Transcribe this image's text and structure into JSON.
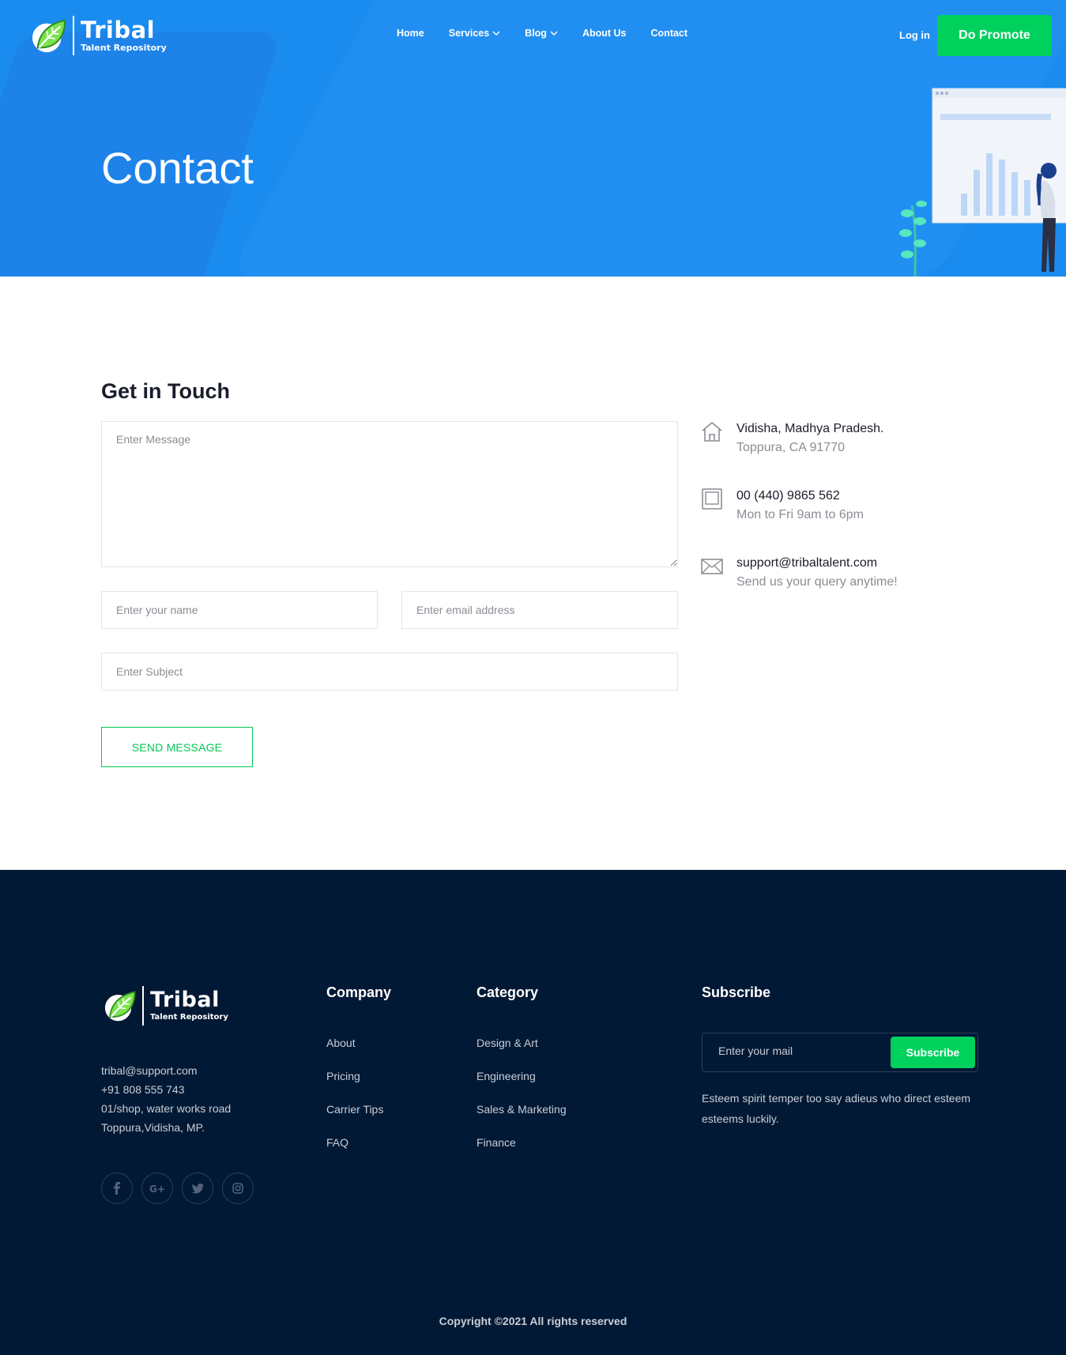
{
  "brand": {
    "name": "Tribal",
    "tagline": "Talent Repository",
    "accent": "#00d15d",
    "primary": "#1a8cf0",
    "footer_bg": "#021935"
  },
  "nav": {
    "items": [
      {
        "label": "Home"
      },
      {
        "label": "Services"
      },
      {
        "label": "Blog"
      },
      {
        "label": "About Us"
      },
      {
        "label": "Contact"
      }
    ],
    "login": "Log in",
    "cta": "Do Promote"
  },
  "hero": {
    "title": "Contact"
  },
  "contact": {
    "title": "Get in Touch",
    "message_placeholder": "Enter Message",
    "name_placeholder": "Enter your name",
    "email_placeholder": "Enter email address",
    "subject_placeholder": "Enter Subject",
    "send_label": "SEND MESSAGE",
    "info": [
      {
        "icon": "home-icon",
        "main": "Vidisha, Madhya Pradesh.",
        "sub": "Toppura, CA 91770"
      },
      {
        "icon": "tablet-icon",
        "main": "00 (440) 9865 562",
        "sub": "Mon to Fri 9am to 6pm"
      },
      {
        "icon": "mail-icon",
        "main": "support@tribaltalent.com",
        "sub": "Send us your query anytime!"
      }
    ]
  },
  "footer": {
    "contact": [
      "tribal@support.com",
      "+91 808 555 743",
      "01/shop, water works road",
      "Toppura,Vidisha, MP."
    ],
    "socials": [
      "facebook-icon",
      "google-plus-icon",
      "twitter-icon",
      "instagram-icon"
    ],
    "company": {
      "title": "Company",
      "links": [
        "About",
        "Pricing",
        "Carrier Tips",
        "FAQ"
      ]
    },
    "category": {
      "title": "Category",
      "links": [
        "Design & Art",
        "Engineering",
        "Sales & Marketing",
        "Finance"
      ]
    },
    "subscribe": {
      "title": "Subscribe",
      "placeholder": "Enter your mail",
      "button": "Subscribe",
      "description": "Esteem spirit temper too say adieus who direct esteem esteems luckily."
    },
    "copyright": "Copyright ©2021 All rights reserved"
  }
}
